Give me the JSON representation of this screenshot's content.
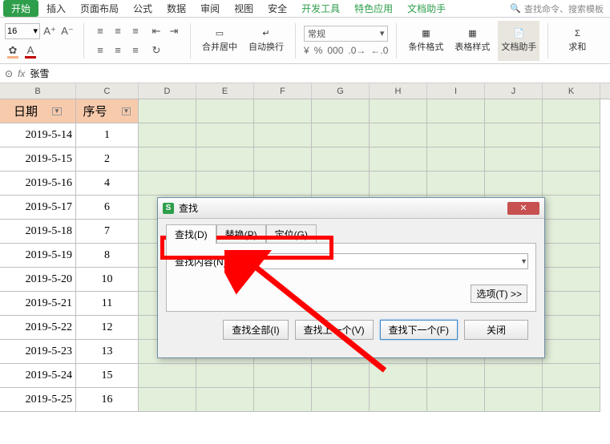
{
  "menu": {
    "items": [
      "开始",
      "插入",
      "页面布局",
      "公式",
      "数据",
      "审阅",
      "视图",
      "安全",
      "开发工具",
      "特色应用",
      "文档助手"
    ],
    "active_index": 0,
    "search_placeholder": "查找命令、搜索模板"
  },
  "ribbon": {
    "font_size": "16",
    "format_label": "常规",
    "merge_label": "合并居中",
    "wrap_label": "自动换行",
    "cond_fmt": "条件格式",
    "table_style": "表格样式",
    "doc_helper": "文档助手",
    "sum_label": "求和"
  },
  "formula": {
    "value": "张雪"
  },
  "columns": [
    "B",
    "C",
    "D",
    "E",
    "F",
    "G",
    "H",
    "I",
    "J",
    "K"
  ],
  "headers": {
    "date": "日期",
    "seq": "序号"
  },
  "rows": [
    {
      "date": "2019-5-14",
      "seq": "1"
    },
    {
      "date": "2019-5-15",
      "seq": "2"
    },
    {
      "date": "2019-5-16",
      "seq": "4"
    },
    {
      "date": "2019-5-17",
      "seq": "6"
    },
    {
      "date": "2019-5-18",
      "seq": "7"
    },
    {
      "date": "2019-5-19",
      "seq": "8"
    },
    {
      "date": "2019-5-20",
      "seq": "10"
    },
    {
      "date": "2019-5-21",
      "seq": "11"
    },
    {
      "date": "2019-5-22",
      "seq": "12"
    },
    {
      "date": "2019-5-23",
      "seq": "13"
    },
    {
      "date": "2019-5-24",
      "seq": "15"
    },
    {
      "date": "2019-5-25",
      "seq": "16"
    }
  ],
  "dialog": {
    "title": "查找",
    "tabs": [
      "查找(D)",
      "替换(P)",
      "定位(G)"
    ],
    "active_tab": 0,
    "find_label": "查找内容(N):",
    "find_value": "",
    "options_btn": "选项(T) >>",
    "buttons": {
      "find_all": "查找全部(I)",
      "find_prev": "查找上一个(V)",
      "find_next": "查找下一个(F)",
      "close": "关闭"
    }
  }
}
